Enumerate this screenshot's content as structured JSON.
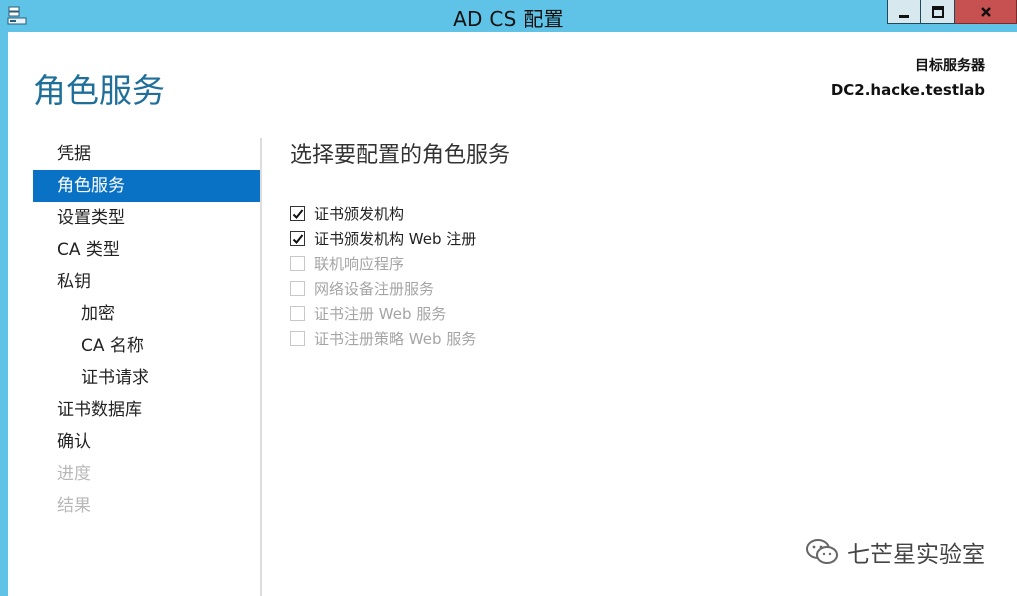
{
  "window": {
    "title": "AD CS 配置"
  },
  "header": {
    "page_title": "角色服务",
    "target_label": "目标服务器",
    "target_value": "DC2.hacke.testlab"
  },
  "nav": {
    "items": [
      {
        "label": "凭据"
      },
      {
        "label": "角色服务"
      },
      {
        "label": "设置类型"
      },
      {
        "label": "CA 类型"
      },
      {
        "label": "私钥"
      },
      {
        "label": "加密"
      },
      {
        "label": "CA 名称"
      },
      {
        "label": "证书请求"
      },
      {
        "label": "证书数据库"
      },
      {
        "label": "确认"
      },
      {
        "label": "进度"
      },
      {
        "label": "结果"
      }
    ]
  },
  "main": {
    "section_title": "选择要配置的角色服务",
    "roles": [
      {
        "label": "证书颁发机构",
        "checked": true,
        "enabled": true
      },
      {
        "label": "证书颁发机构 Web 注册",
        "checked": true,
        "enabled": true
      },
      {
        "label": "联机响应程序",
        "checked": false,
        "enabled": false
      },
      {
        "label": "网络设备注册服务",
        "checked": false,
        "enabled": false
      },
      {
        "label": "证书注册 Web 服务",
        "checked": false,
        "enabled": false
      },
      {
        "label": "证书注册策略 Web 服务",
        "checked": false,
        "enabled": false
      }
    ]
  },
  "watermark": {
    "text": "七芒星实验室"
  },
  "colors": {
    "titlebar": "#5ec3e7",
    "accent": "#0a72c4",
    "heading": "#1f6f9a",
    "close": "#c75050"
  }
}
